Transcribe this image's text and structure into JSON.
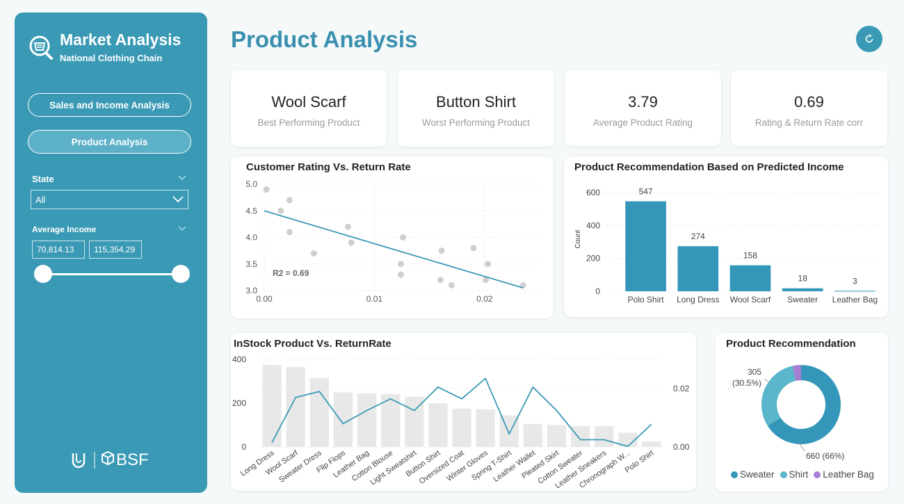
{
  "sidebar": {
    "title": "Market Analysis",
    "subtitle": "National Clothing Chain",
    "nav": [
      {
        "label": "Sales and Income Analysis",
        "active": false
      },
      {
        "label": "Product Analysis",
        "active": true
      }
    ],
    "state_filter": {
      "label": "State",
      "value": "All"
    },
    "income_filter": {
      "label": "Average Income",
      "min": "70,814.13",
      "max": "115,354.29"
    },
    "footer_text": "BSF"
  },
  "header": {
    "title": "Product Analysis"
  },
  "kpis": [
    {
      "value": "Wool Scarf",
      "label": "Best Performing Product"
    },
    {
      "value": "Button Shirt",
      "label": "Worst Performing Product"
    },
    {
      "value": "3.79",
      "label": "Average Product Rating"
    },
    {
      "value": "0.69",
      "label": "Rating & Return Rate corr"
    }
  ],
  "colors": {
    "accent": "#3a9ab5",
    "bars": "#e8e8e8",
    "donut_sweater": "#3497b9",
    "donut_shirt": "#5ab6cb",
    "donut_leather": "#a57fd6"
  },
  "chart_data": [
    {
      "type": "scatter",
      "title": "Customer Rating Vs. Return Rate",
      "xlim": [
        0,
        0.025
      ],
      "ylim": [
        3.0,
        5.0
      ],
      "x_ticks": [
        "0.00",
        "0.01",
        "0.02"
      ],
      "y_ticks": [
        "3.0",
        "3.5",
        "4.0",
        "4.5",
        "5.0"
      ],
      "annotation": "R2 = 0.69",
      "points": [
        {
          "x": 0.0002,
          "y": 4.9
        },
        {
          "x": 0.0015,
          "y": 4.5
        },
        {
          "x": 0.0023,
          "y": 4.7
        },
        {
          "x": 0.0023,
          "y": 4.1
        },
        {
          "x": 0.0045,
          "y": 3.7
        },
        {
          "x": 0.0076,
          "y": 4.2
        },
        {
          "x": 0.0079,
          "y": 3.9
        },
        {
          "x": 0.0124,
          "y": 3.5
        },
        {
          "x": 0.0124,
          "y": 3.3
        },
        {
          "x": 0.0126,
          "y": 4.0
        },
        {
          "x": 0.0161,
          "y": 3.75
        },
        {
          "x": 0.016,
          "y": 3.2
        },
        {
          "x": 0.017,
          "y": 3.1
        },
        {
          "x": 0.019,
          "y": 3.8
        },
        {
          "x": 0.0203,
          "y": 3.5
        },
        {
          "x": 0.0201,
          "y": 3.2
        },
        {
          "x": 0.0235,
          "y": 3.1
        }
      ],
      "trendline": [
        {
          "x": 0.0,
          "y": 4.5
        },
        {
          "x": 0.0235,
          "y": 3.05
        }
      ]
    },
    {
      "type": "bar",
      "title": "Product Recommendation Based on Predicted Income",
      "ylabel": "Count",
      "ylim": [
        0,
        600
      ],
      "y_ticks": [
        "0",
        "200",
        "400",
        "600"
      ],
      "categories": [
        "Polo Shirt",
        "Long Dress",
        "Wool Scarf",
        "Sweater",
        "Leather Bag"
      ],
      "values": [
        547,
        274,
        158,
        18,
        3
      ]
    },
    {
      "type": "bar",
      "title": "InStock Product Vs. ReturnRate",
      "ylim": [
        0,
        400
      ],
      "y_ticks": [
        "0",
        "200",
        "400"
      ],
      "y2_ticks": [
        "0.00",
        "0.02"
      ],
      "y2lim": [
        0,
        0.03
      ],
      "categories": [
        "Long Dress",
        "Wool Scarf",
        "Sweater Dress",
        "Flip Flops",
        "Leather Bag",
        "Cotton Blouse",
        "Light Sweatshirt",
        "Button Shirt",
        "Oversized Coat",
        "Winter Gloves",
        "Spring T-Shirt",
        "Leather Wallet",
        "Pleated Skirt",
        "Cotton Sweater",
        "Leather Sneakers",
        "Chronograph W...",
        "Polo Shirt"
      ],
      "values": [
        375,
        365,
        315,
        250,
        245,
        242,
        230,
        200,
        175,
        172,
        145,
        105,
        100,
        95,
        95,
        65,
        25
      ],
      "line_values": [
        0.0015,
        0.017,
        0.019,
        0.008,
        0.0125,
        0.0165,
        0.0125,
        0.0205,
        0.0165,
        0.0235,
        0.0045,
        0.0205,
        0.0125,
        0.0025,
        0.0025,
        0.0002,
        0.0078
      ]
    },
    {
      "type": "pie",
      "title": "Product Recommendation",
      "labels": [
        "Sweater",
        "Shirt",
        "Leather Bag"
      ],
      "values": [
        660,
        305,
        35
      ],
      "data_labels": [
        "660 (66%)",
        "305\n(30.5%)"
      ]
    }
  ]
}
